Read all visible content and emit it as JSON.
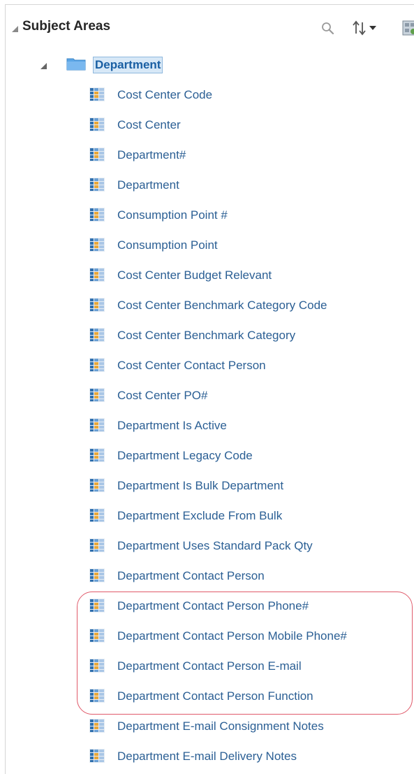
{
  "panel": {
    "title": "Subject Areas",
    "tools": [
      "search-icon",
      "sort-icon",
      "new-object-icon"
    ]
  },
  "folder": {
    "label": "Department",
    "selected": true,
    "expanded": true
  },
  "columns": [
    "Cost Center Code",
    "Cost Center",
    "Department#",
    "Department",
    "Consumption Point #",
    "Consumption Point",
    "Cost Center Budget Relevant",
    "Cost Center Benchmark Category Code",
    "Cost Center Benchmark Category",
    "Cost Center Contact Person",
    "Cost Center PO#",
    "Department Is Active",
    "Department Legacy Code",
    "Department Is Bulk Department",
    "Department Exclude From Bulk",
    "Department Uses Standard Pack Qty",
    "Department Contact Person",
    "Department Contact Person Phone#",
    "Department Contact Person Mobile Phone#",
    "Department Contact Person E-mail",
    "Department Contact Person Function",
    "Department E-mail Consignment Notes",
    "Department E-mail Delivery Notes"
  ],
  "colors": {
    "link": "#2b5f94",
    "highlight_outline": "#e05a6a",
    "selection_bg": "#d7e8f7"
  }
}
